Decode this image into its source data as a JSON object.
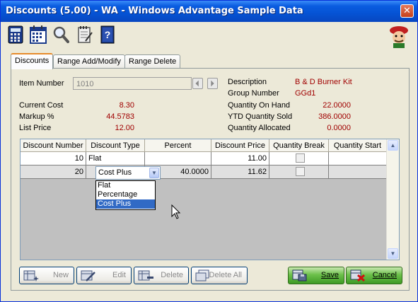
{
  "window": {
    "title": "Discounts (5.00) - WA - Windows Advantage Sample Data",
    "close_glyph": "✕"
  },
  "toolbar": {
    "icons": [
      "calculator-icon",
      "calendar-icon",
      "magnifier-icon",
      "notepad-icon",
      "help-book-icon",
      "mascot-icon"
    ]
  },
  "tabs": [
    {
      "label": "Discounts",
      "active": true
    },
    {
      "label": "Range Add/Modify",
      "active": false
    },
    {
      "label": "Range Delete",
      "active": false
    }
  ],
  "item": {
    "number_label": "Item Number",
    "number_value": "1010",
    "description_label": "Description",
    "description_value": "B & D Burner Kit",
    "group_label": "Group Number",
    "group_value": "GGd1",
    "current_cost_label": "Current Cost",
    "current_cost_value": "8.30",
    "markup_label": "Markup %",
    "markup_value": "44.5783",
    "list_price_label": "List Price",
    "list_price_value": "12.00",
    "qty_on_hand_label": "Quantity On Hand",
    "qty_on_hand_value": "22.0000",
    "ytd_qty_label": "YTD Quantity Sold",
    "ytd_qty_value": "386.0000",
    "qty_alloc_label": "Quantity Allocated",
    "qty_alloc_value": "0.0000"
  },
  "grid": {
    "columns": [
      "Discount Number",
      "Discount Type",
      "Percent",
      "Discount Price",
      "Quantity Break",
      "Quantity Start"
    ],
    "rows": [
      {
        "number": "10",
        "type": "Flat",
        "percent": "",
        "price": "11.00",
        "qty_start": ""
      },
      {
        "number": "20",
        "type": "Cost Plus",
        "percent": "40.0000",
        "price": "11.62",
        "qty_start": ""
      }
    ]
  },
  "dropdown": {
    "selected": "Cost Plus",
    "options": [
      "Flat",
      "Percentage",
      "Cost Plus"
    ]
  },
  "buttons": {
    "new": "New",
    "edit": "Edit",
    "delete": "Delete",
    "delete_all": "Delete All",
    "save": "Save",
    "cancel": "Cancel"
  },
  "colors": {
    "value_red": "#a00000",
    "title_blue": "#0553d4",
    "selection_blue": "#316ac5",
    "save_green": "#3e9a25"
  }
}
